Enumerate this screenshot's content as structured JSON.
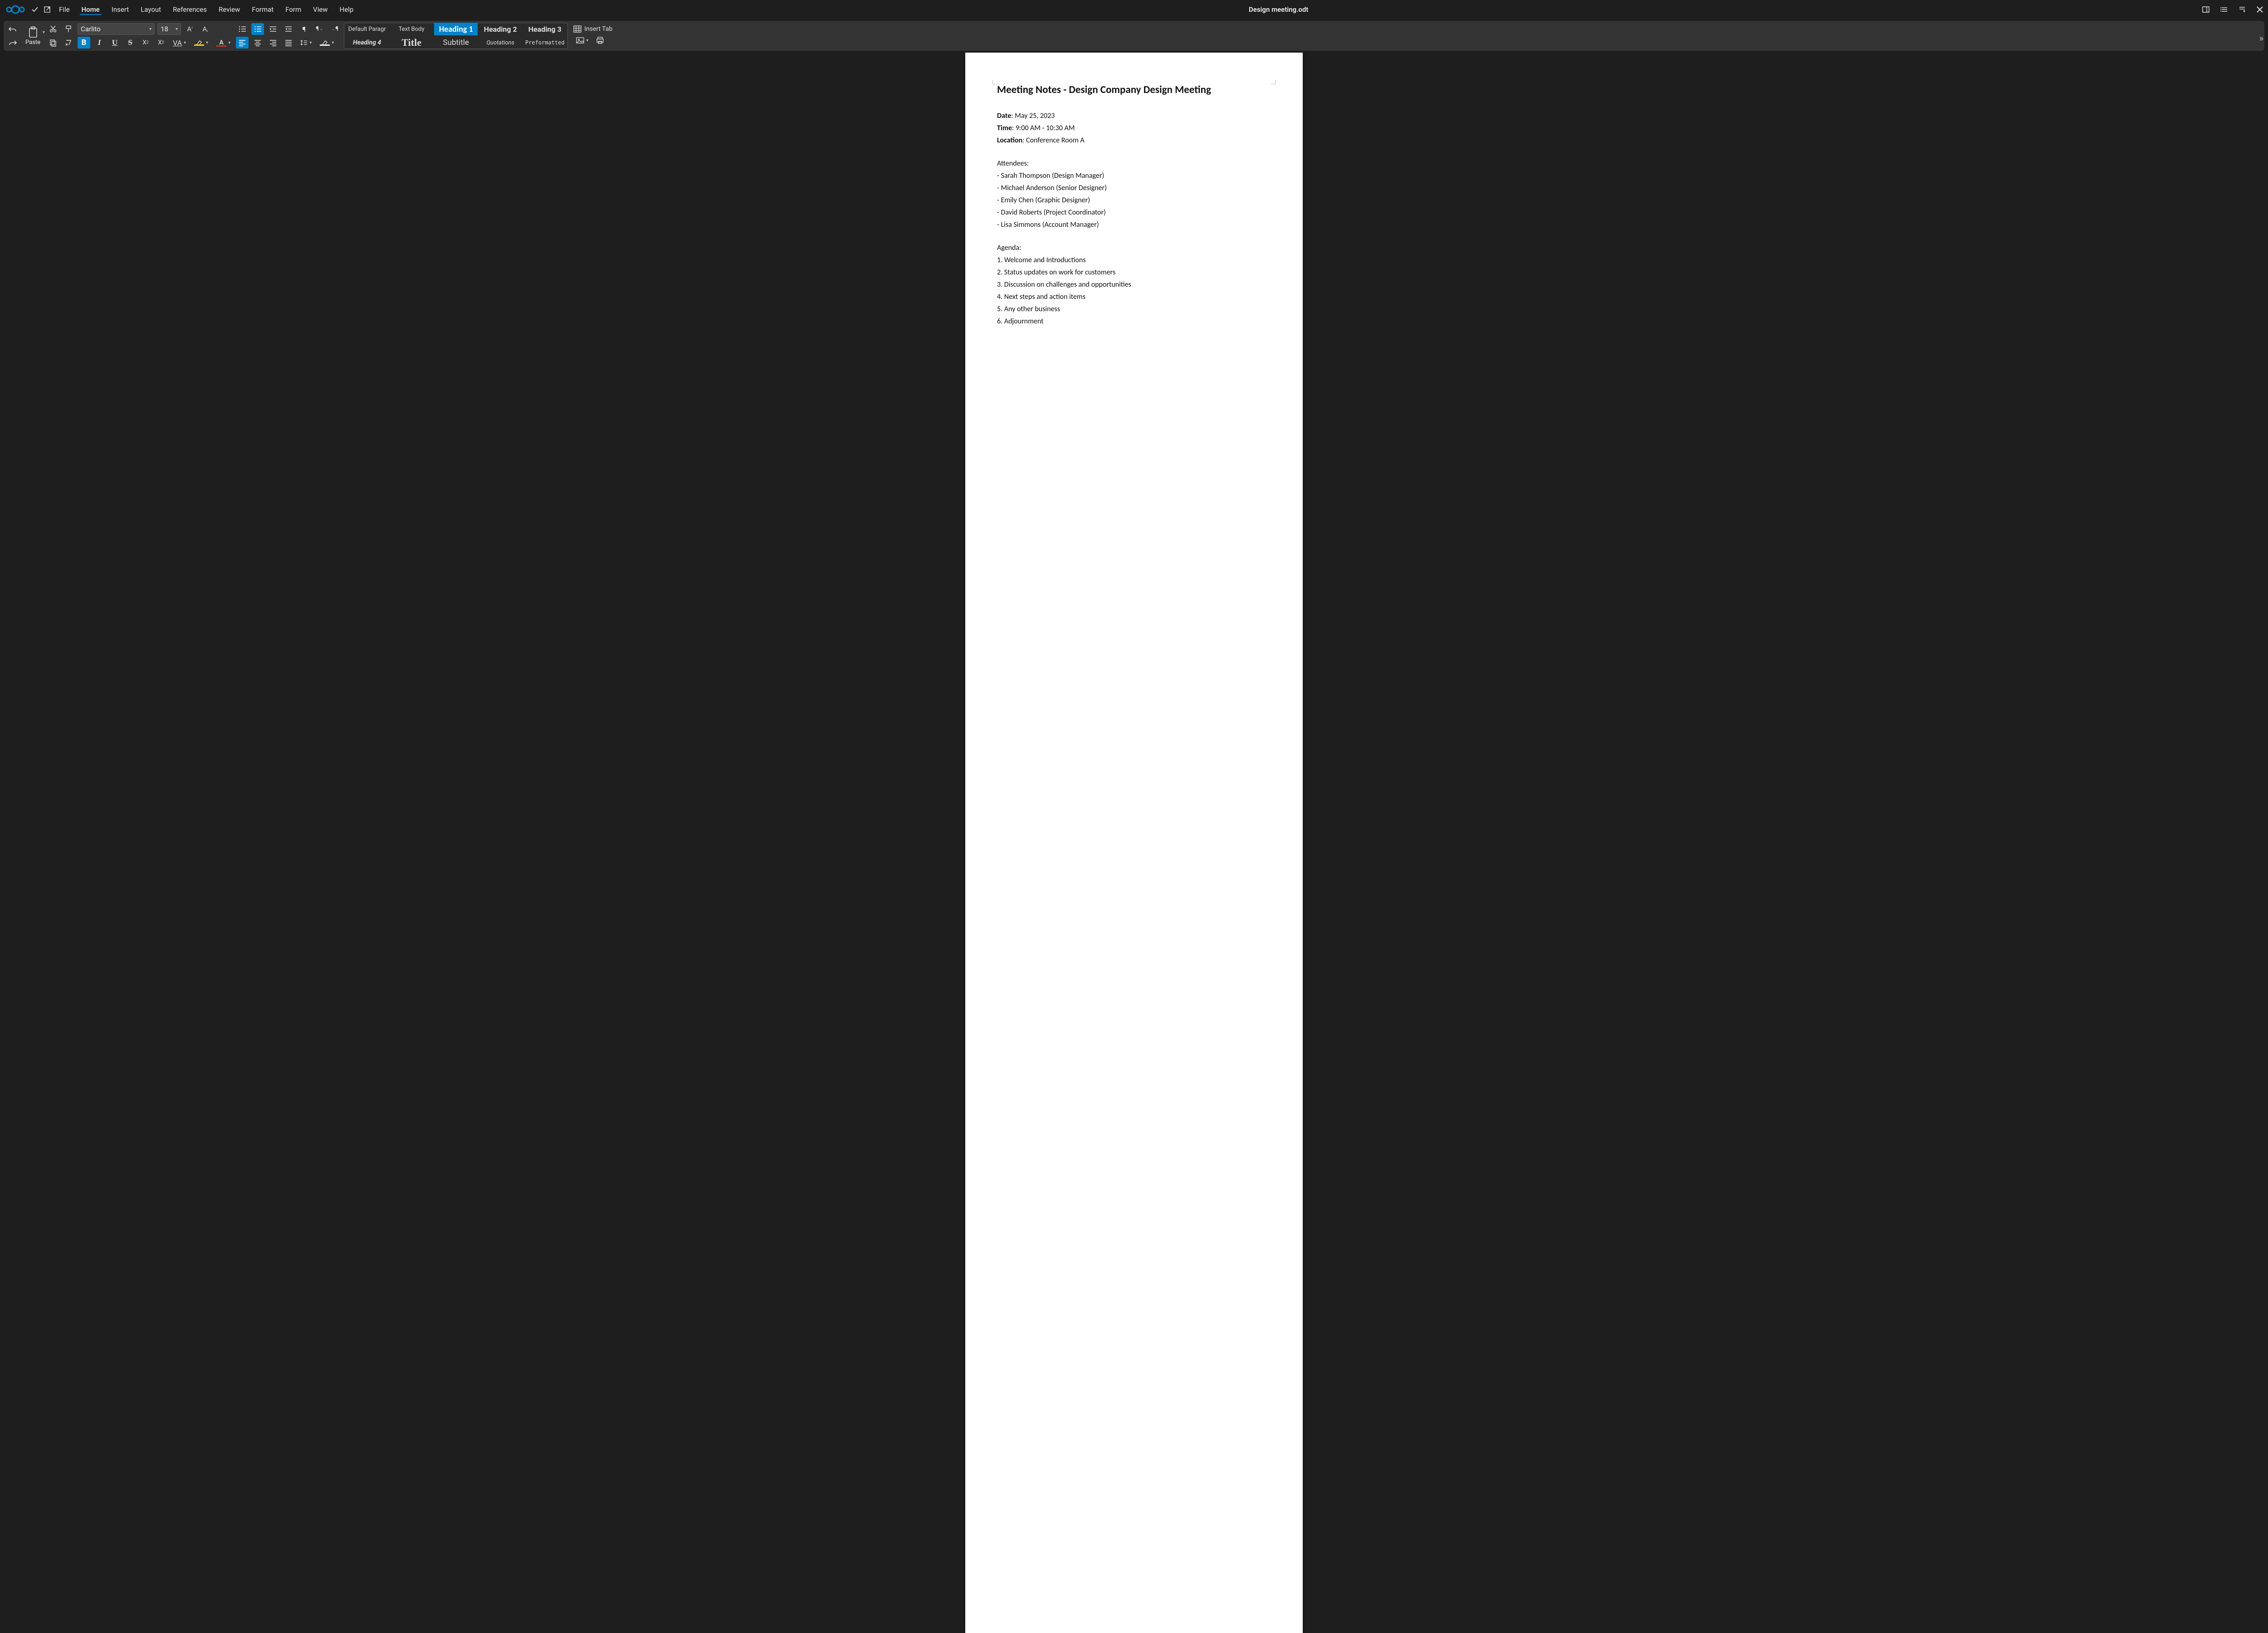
{
  "titlebar": {
    "document_title": "Design meeting.odt",
    "menus": [
      "File",
      "Home",
      "Insert",
      "Layout",
      "References",
      "Review",
      "Format",
      "Form",
      "View",
      "Help"
    ],
    "active_menu_index": 1
  },
  "ribbon": {
    "paste_label": "Paste",
    "font_name": "Carlito",
    "font_size": "18",
    "styles_row1": [
      "Default Paragr",
      "Text Body",
      "Heading 1",
      "Heading 2",
      "Heading 3"
    ],
    "styles_row2": [
      "Heading 4",
      "Title",
      "Subtitle",
      "Quotations",
      "Preformatted"
    ],
    "active_style_index": 2,
    "insert_table_label": "Insert Tab",
    "bold_active": true,
    "unordered_list_active": true,
    "align_left_active": true
  },
  "document": {
    "heading": "Meeting Notes - Design Company Design Meeting",
    "meta": {
      "date_label": "Date",
      "date_value": ": May 25, 2023",
      "time_label": "Time",
      "time_value": ": 9:00 AM - 10:30 AM",
      "location_label": "Location",
      "location_value": ": Conference Room A"
    },
    "attendees_header": "Attendees:",
    "attendees": [
      "- Sarah Thompson (Design Manager)",
      "- Michael Anderson (Senior Designer)",
      "- Emily Chen (Graphic Designer)",
      "- David Roberts (Project Coordinator)",
      "- Lisa Simmons (Account Manager)"
    ],
    "agenda_header": "Agenda:",
    "agenda": [
      "1. Welcome and Introductions",
      "2. Status updates on work for customers",
      "3. Discussion on challenges and opportunities",
      "4. Next steps and action items",
      "5. Any other business",
      "6. Adjournment"
    ]
  }
}
